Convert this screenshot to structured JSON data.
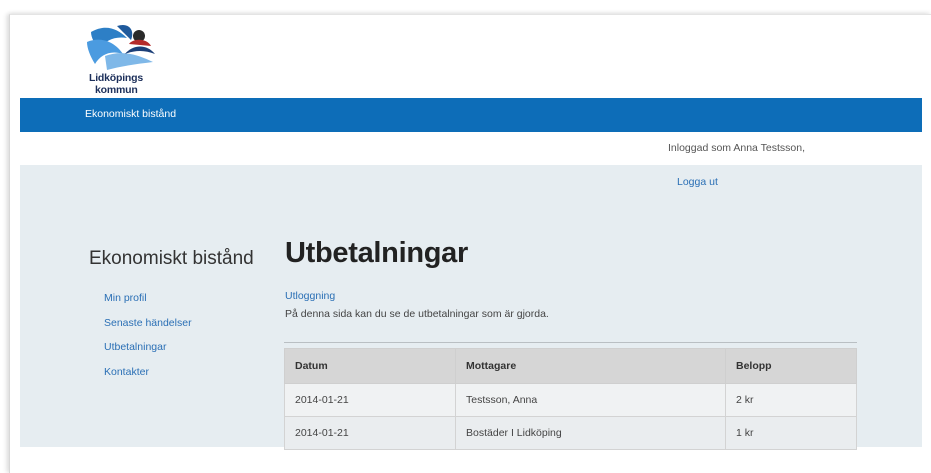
{
  "logo": {
    "line1": "Lidköpings",
    "line2": "kommun"
  },
  "navbar": {
    "link": "Ekonomiskt bistånd"
  },
  "session": {
    "logged_in_text": "Inloggad som Anna Testsson,",
    "logout_label": "Logga ut"
  },
  "sidebar": {
    "title": "Ekonomiskt bistånd",
    "items": [
      {
        "label": "Min profil"
      },
      {
        "label": "Senaste händelser"
      },
      {
        "label": "Utbetalningar"
      },
      {
        "label": "Kontakter"
      }
    ]
  },
  "main": {
    "title": "Utbetalningar",
    "logout_link": "Utloggning",
    "description": "På denna sida kan du se de utbetalningar som är gjorda.",
    "table": {
      "headers": [
        "Datum",
        "Mottagare",
        "Belopp"
      ],
      "rows": [
        [
          "2014-01-21",
          "Testsson, Anna",
          "2 kr"
        ],
        [
          "2014-01-21",
          "Bostäder I Lidköping",
          "1 kr"
        ]
      ]
    }
  },
  "colors": {
    "nav_bg": "#0d6db8",
    "content_bg": "#e6edf1",
    "link": "#2a6fb5"
  }
}
